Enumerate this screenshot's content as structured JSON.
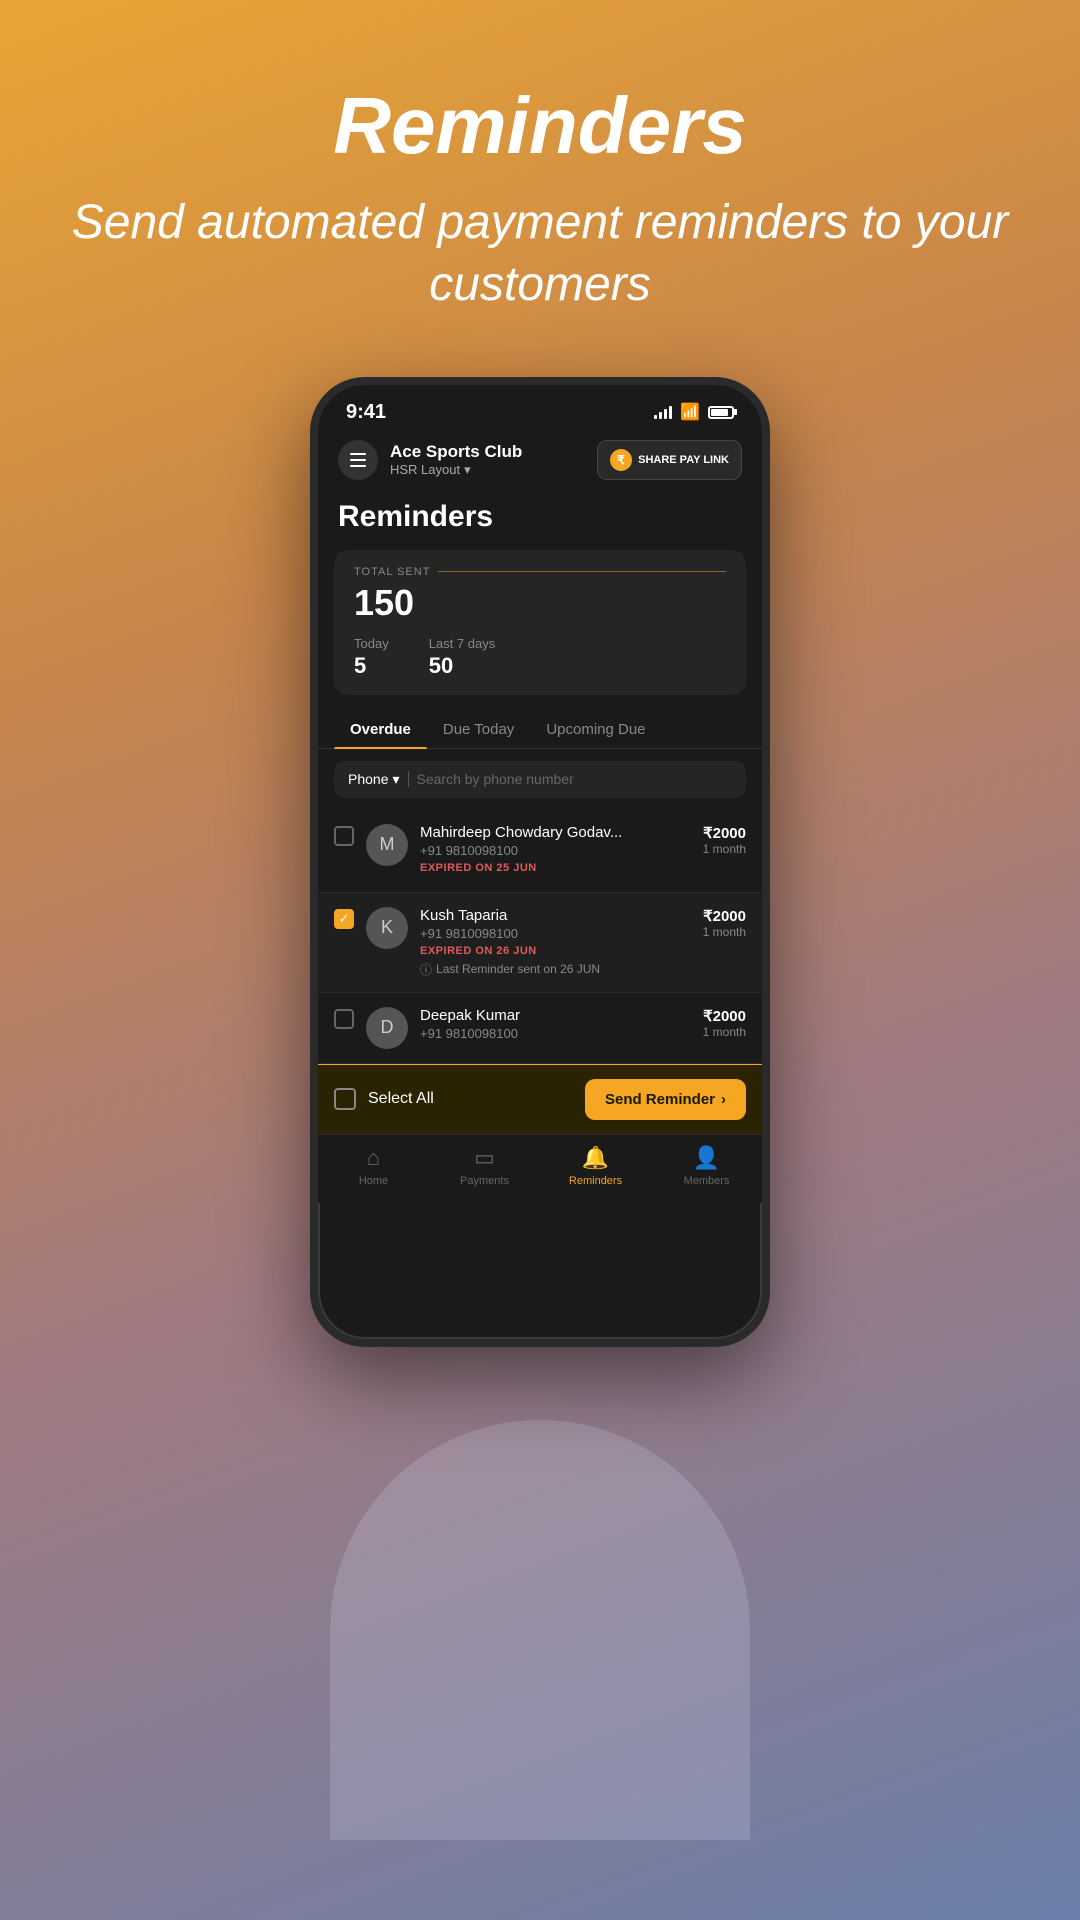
{
  "promo": {
    "title": "Reminders",
    "subtitle": "Send automated payment reminders to your customers"
  },
  "status_bar": {
    "time": "9:41",
    "signal": "●●●●",
    "wifi": "wifi",
    "battery": "battery"
  },
  "header": {
    "menu_label": "menu",
    "club_name": "Ace Sports Club",
    "location": "HSR Layout",
    "share_button": "SHARE PAY LINK",
    "rupee_symbol": "₹"
  },
  "page": {
    "title": "Reminders"
  },
  "stats": {
    "label": "TOTAL SENT",
    "total": "150",
    "today_label": "Today",
    "today_value": "5",
    "last7_label": "Last 7 days",
    "last7_value": "50"
  },
  "tabs": [
    {
      "id": "overdue",
      "label": "Overdue",
      "active": true
    },
    {
      "id": "due-today",
      "label": "Due Today",
      "active": false
    },
    {
      "id": "upcoming-due",
      "label": "Upcoming Due",
      "active": false
    }
  ],
  "search": {
    "filter_label": "Phone",
    "placeholder": "Search by phone number"
  },
  "customers": [
    {
      "id": 1,
      "name": "Mahirdeep Chowdary Godav...",
      "phone": "+91 9810098100",
      "amount": "₹2000",
      "duration": "1 month",
      "expired_on": "EXPIRED ON 25 JUN",
      "checked": false,
      "has_reminder": false,
      "avatar_initials": "M"
    },
    {
      "id": 2,
      "name": "Kush Taparia",
      "phone": "+91 9810098100",
      "amount": "₹2000",
      "duration": "1 month",
      "expired_on": "EXPIRED ON 26 JUN",
      "checked": true,
      "has_reminder": true,
      "reminder_text": "Last Reminder sent on 26 JUN",
      "avatar_initials": "K"
    },
    {
      "id": 3,
      "name": "Deepak Kumar",
      "phone": "+91 9810098100",
      "amount": "₹2000",
      "duration": "1 month",
      "expired_on": "",
      "checked": false,
      "has_reminder": false,
      "avatar_initials": "D"
    }
  ],
  "action_bar": {
    "select_all_label": "Select All",
    "send_reminder_label": "Send Reminder",
    "arrow": "›"
  },
  "bottom_nav": [
    {
      "id": "home",
      "icon": "🏠",
      "label": "Home",
      "active": false
    },
    {
      "id": "payments",
      "icon": "💳",
      "label": "Payments",
      "active": false
    },
    {
      "id": "reminders",
      "icon": "🔔",
      "label": "Reminders",
      "active": true
    },
    {
      "id": "members",
      "icon": "👤",
      "label": "Members",
      "active": false
    }
  ]
}
